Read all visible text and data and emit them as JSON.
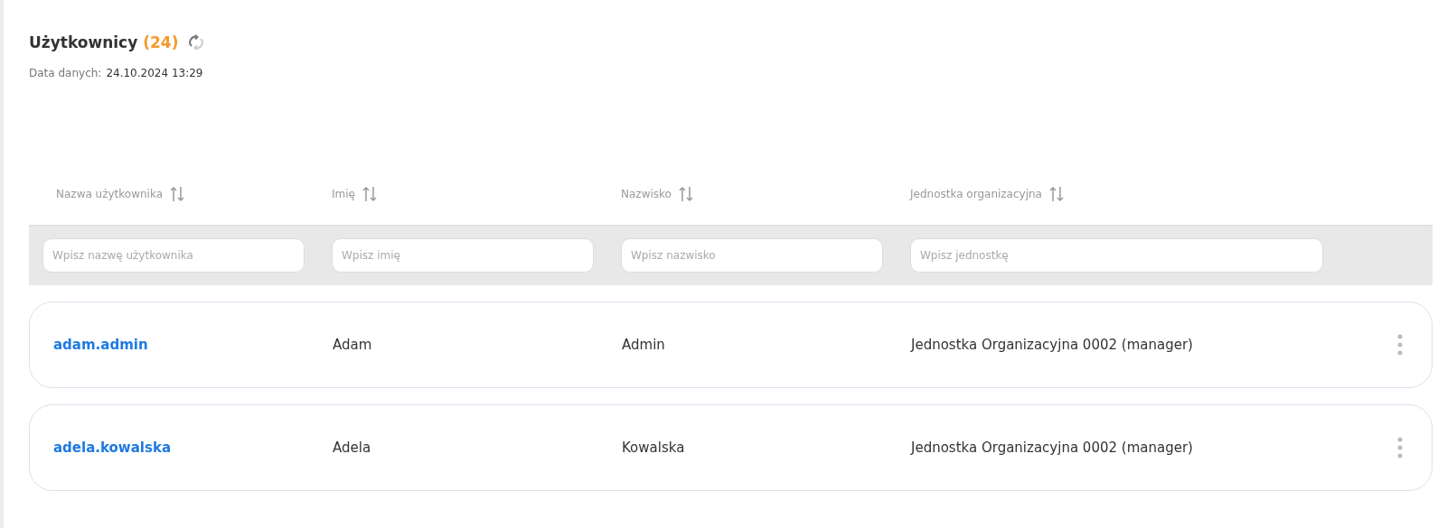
{
  "header": {
    "title": "Użytkownicy",
    "count": "(24)",
    "data_label": "Data danych:",
    "data_value": "24.10.2024 13:29"
  },
  "table": {
    "columns": [
      {
        "label": "Nazwa użytkownika",
        "placeholder": "Wpisz nazwę użytkownika"
      },
      {
        "label": "Imię",
        "placeholder": "Wpisz imię"
      },
      {
        "label": "Nazwisko",
        "placeholder": "Wpisz nazwisko"
      },
      {
        "label": "Jednostka organizacyjna",
        "placeholder": "Wpisz jednostkę"
      }
    ],
    "rows": [
      {
        "username": "adam.admin",
        "first_name": "Adam",
        "last_name": "Admin",
        "unit": "Jednostka Organizacyjna 0002 (manager)"
      },
      {
        "username": "adela.kowalska",
        "first_name": "Adela",
        "last_name": "Kowalska",
        "unit": "Jednostka Organizacyjna 0002 (manager)"
      }
    ]
  }
}
